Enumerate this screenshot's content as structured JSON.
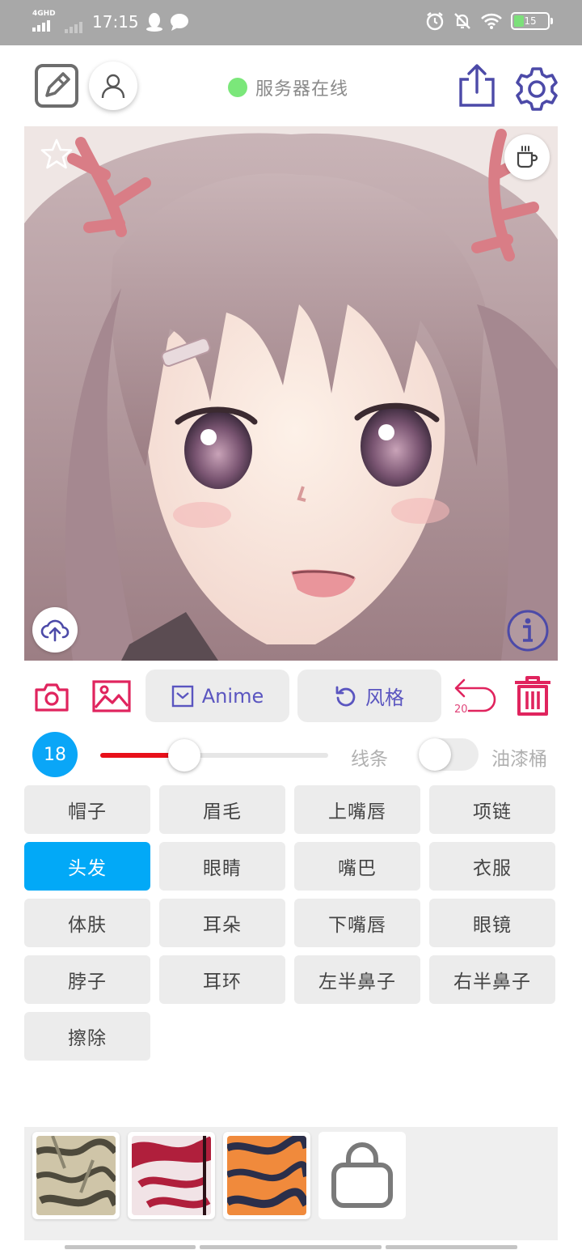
{
  "status_bar": {
    "network_label": "4GHD",
    "time": "17:15",
    "battery_level": "15",
    "icons": [
      "qq-icon",
      "message-icon",
      "alarm-icon",
      "mute-icon",
      "wifi-icon",
      "battery-icon"
    ]
  },
  "header": {
    "server_status": "服务器在线",
    "server_status_color": "#7be77a",
    "accent_color": "#5a55c0"
  },
  "tools": {
    "anime_label": "Anime",
    "style_label": "风格",
    "undo_count": "20",
    "danger_color": "#e0245e"
  },
  "brush": {
    "size": "18",
    "size_fraction": 0.37,
    "line_label": "线条",
    "bucket_label": "油漆桶",
    "bucket_enabled": false
  },
  "parts": [
    {
      "label": "帽子",
      "active": false
    },
    {
      "label": "眉毛",
      "active": false
    },
    {
      "label": "上嘴唇",
      "active": false
    },
    {
      "label": "项链",
      "active": false
    },
    {
      "label": "头发",
      "active": true
    },
    {
      "label": "眼睛",
      "active": false
    },
    {
      "label": "嘴巴",
      "active": false
    },
    {
      "label": "衣服",
      "active": false
    },
    {
      "label": "体肤",
      "active": false
    },
    {
      "label": "耳朵",
      "active": false
    },
    {
      "label": "下嘴唇",
      "active": false
    },
    {
      "label": "眼镜",
      "active": false
    },
    {
      "label": "脖子",
      "active": false
    },
    {
      "label": "耳环",
      "active": false
    },
    {
      "label": "左半鼻子",
      "active": false
    },
    {
      "label": "右半鼻子",
      "active": false
    },
    {
      "label": "擦除",
      "active": false
    }
  ],
  "textures": [
    {
      "name": "texture-camo-beige",
      "colors": [
        "#cfc5a8",
        "#4e4a3c"
      ]
    },
    {
      "name": "texture-crimson-white",
      "colors": [
        "#f1e3e6",
        "#b01f3c"
      ]
    },
    {
      "name": "texture-orange-tiger",
      "colors": [
        "#f08a3c",
        "#2b2f4a"
      ]
    }
  ]
}
